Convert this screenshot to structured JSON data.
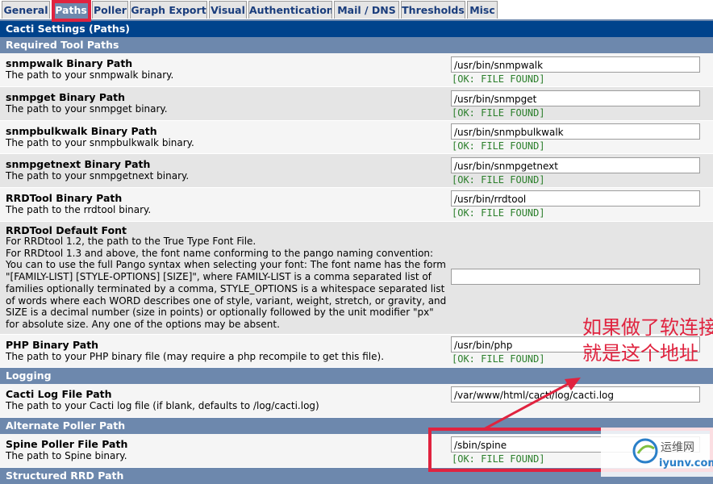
{
  "tabs": [
    "General",
    "Paths",
    "Poller",
    "Graph Export",
    "Visual",
    "Authentication",
    "Mail / DNS",
    "Thresholds",
    "Misc"
  ],
  "page_header": "Cacti Settings (Paths)",
  "sections": {
    "required_tool_paths": "Required Tool Paths",
    "logging": "Logging",
    "alternate_poller_path": "Alternate Poller Path",
    "structured_rrd_path": "Structured RRD Path"
  },
  "rows": {
    "snmpwalk": {
      "title": "snmpwalk Binary Path",
      "desc": "The path to your snmpwalk binary.",
      "value": "/usr/bin/snmpwalk",
      "status": "[OK: FILE FOUND]"
    },
    "snmpget": {
      "title": "snmpget Binary Path",
      "desc": "The path to your snmpget binary.",
      "value": "/usr/bin/snmpget",
      "status": "[OK: FILE FOUND]"
    },
    "snmpbulkwalk": {
      "title": "snmpbulkwalk Binary Path",
      "desc": "The path to your snmpbulkwalk binary.",
      "value": "/usr/bin/snmpbulkwalk",
      "status": "[OK: FILE FOUND]"
    },
    "snmpgetnext": {
      "title": "snmpgetnext Binary Path",
      "desc": "The path to your snmpgetnext binary.",
      "value": "/usr/bin/snmpgetnext",
      "status": "[OK: FILE FOUND]"
    },
    "rrdtool": {
      "title": "RRDTool Binary Path",
      "desc": "The path to the rrdtool binary.",
      "value": "/usr/bin/rrdtool",
      "status": "[OK: FILE FOUND]"
    },
    "rrdtool_font": {
      "title": "RRDTool Default Font",
      "desc": "For RRDtool 1.2, the path to the True Type Font File.\nFor RRDtool 1.3 and above, the font name conforming to the pango naming convention:\nYou can to use the full Pango syntax when selecting your font: The font name has the form \"[FAMILY-LIST] [STYLE-OPTIONS] [SIZE]\", where FAMILY-LIST is a comma separated list of families optionally terminated by a comma, STYLE_OPTIONS is a whitespace separated list of words where each WORD describes one of style, variant, weight, stretch, or gravity, and SIZE is a decimal number (size in points) or optionally followed by the unit modifier \"px\" for absolute size. Any one of the options may be absent.",
      "value": ""
    },
    "php": {
      "title": "PHP Binary Path",
      "desc": "The path to your PHP binary file (may require a php recompile to get this file).",
      "value": "/usr/bin/php",
      "status": "[OK: FILE FOUND]"
    },
    "cacti_log": {
      "title": "Cacti Log File Path",
      "desc": "The path to your Cacti log file (if blank, defaults to /log/cacti.log)",
      "value": "/var/www/html/cacti/log/cacti.log"
    },
    "spine": {
      "title": "Spine Poller File Path",
      "desc": "The path to Spine binary.",
      "value": "/sbin/spine",
      "status": "[OK: FILE FOUND]"
    }
  },
  "annotation": {
    "text": "如果做了软连接就是这个地址",
    "color": "#e0233f"
  },
  "watermark": {
    "cn": "运维网",
    "en": "iyunv.com"
  },
  "colors": {
    "header_dark": "#00438c",
    "section": "#6d88ad",
    "ok_green": "#2b7f2b",
    "tab_text": "#1a3d7c"
  }
}
